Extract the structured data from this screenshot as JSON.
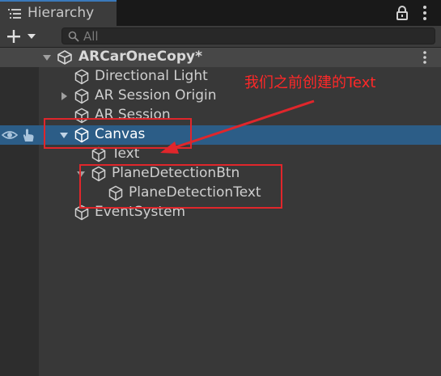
{
  "window": {
    "tab_title": "Hierarchy",
    "tab_icon": "list-icon",
    "lock_icon": "lock-icon",
    "menu_icon": "kebab-menu-icon"
  },
  "toolbar": {
    "create_icon": "plus-dropdown-icon",
    "search_icon": "search-icon",
    "search_placeholder": "All",
    "search_value": ""
  },
  "hierarchy": {
    "scene": {
      "name": "ARCarOneCopy*",
      "icon": "unity-icon",
      "expanded": true
    },
    "items": [
      {
        "label": "Directional Light",
        "icon": "gameobject-cube-icon",
        "depth": 1,
        "has_children": false
      },
      {
        "label": "AR Session Origin",
        "icon": "gameobject-cube-icon",
        "depth": 1,
        "has_children": true,
        "expanded": false
      },
      {
        "label": "AR Session",
        "icon": "gameobject-cube-icon",
        "depth": 1,
        "has_children": false
      },
      {
        "label": "Canvas",
        "icon": "gameobject-cube-icon",
        "depth": 1,
        "has_children": true,
        "expanded": true,
        "selected": true
      },
      {
        "label": "Text",
        "icon": "gameobject-cube-icon",
        "depth": 2,
        "has_children": false
      },
      {
        "label": "PlaneDetectionBtn",
        "icon": "gameobject-cube-icon",
        "depth": 2,
        "has_children": true,
        "expanded": true
      },
      {
        "label": "PlaneDetectionText",
        "icon": "gameobject-cube-icon",
        "depth": 3,
        "has_children": false
      },
      {
        "label": "EventSystem",
        "icon": "gameobject-cube-icon",
        "depth": 1,
        "has_children": false
      }
    ]
  },
  "annotation": {
    "text": "我们之前创建的Text",
    "color": "#e0262b"
  },
  "colors": {
    "selection": "#2c5d87",
    "tab_accent": "#3a79bb",
    "panel_bg": "#383838"
  }
}
